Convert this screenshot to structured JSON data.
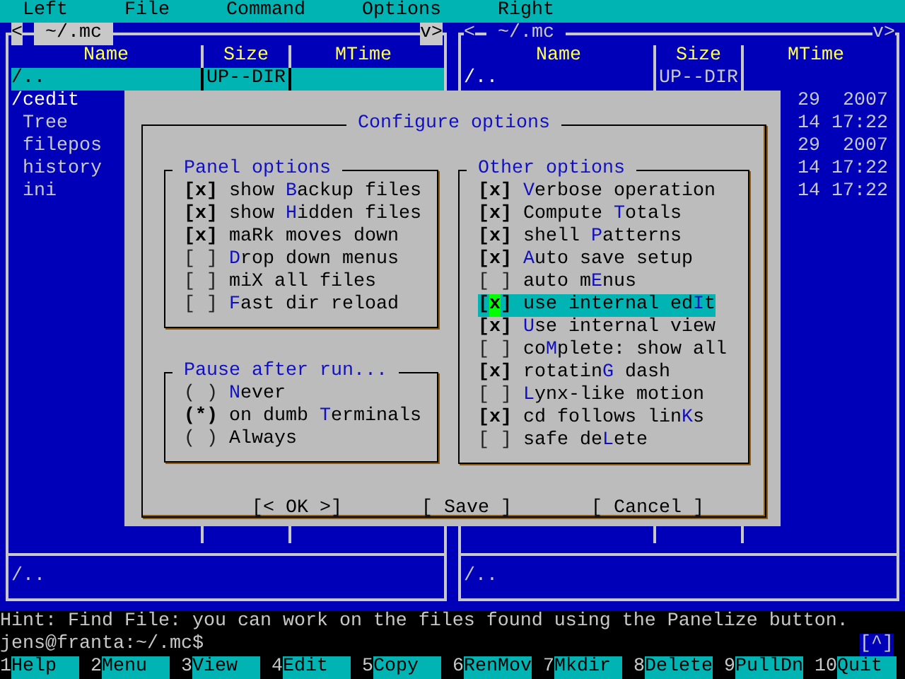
{
  "menu_bar": [
    "Left",
    "File",
    "Command",
    "Options",
    "Right"
  ],
  "panels": [
    {
      "active": true,
      "scroll_left": "<",
      "path": "~/.mc",
      "scroll_right": "v>",
      "columns": [
        "Name",
        "Size",
        "MTime"
      ],
      "cursor_row": {
        "name": "/..",
        "size": "UP--DIR",
        "kind": "dir"
      },
      "rows": [
        {
          "name": "/cedit",
          "kind": "dir"
        },
        {
          "name": "Tree",
          "kind": "file"
        },
        {
          "name": "filepos",
          "kind": "file"
        },
        {
          "name": "history",
          "kind": "file"
        },
        {
          "name": "ini",
          "kind": "file"
        }
      ],
      "status": "/.."
    },
    {
      "active": false,
      "scroll_left": "<",
      "path": "~/.mc",
      "scroll_right": "v>",
      "columns": [
        "Name",
        "Size",
        "MTime"
      ],
      "cursor_row": {
        "name": "/..",
        "size": "UP--DIR",
        "kind": "dir"
      },
      "rows": [
        {
          "mtime": "29  2007"
        },
        {
          "mtime": "14 17:22"
        },
        {
          "mtime": "29  2007"
        },
        {
          "mtime": "14 17:22"
        },
        {
          "mtime": "14 17:22"
        }
      ],
      "status": "/.."
    }
  ],
  "dialog": {
    "title": "Configure options",
    "columns": [
      {
        "groups": [
          {
            "title": "Panel options",
            "kind": "checkbox",
            "items": [
              {
                "box": "[x]",
                "checked": true,
                "focused": false,
                "pre": "show ",
                "key": "B",
                "post": "ackup files"
              },
              {
                "box": "[x]",
                "checked": true,
                "focused": false,
                "pre": "show ",
                "key": "H",
                "post": "idden files"
              },
              {
                "box": "[x]",
                "checked": true,
                "focused": false,
                "pre": "maRk moves down"
              },
              {
                "box": "[ ]",
                "checked": false,
                "focused": false,
                "key": "D",
                "post": "rop down menus"
              },
              {
                "box": "[ ]",
                "checked": false,
                "focused": false,
                "pre": "miX all files"
              },
              {
                "box": "[ ]",
                "checked": false,
                "focused": false,
                "key": "F",
                "post": "ast dir reload"
              }
            ]
          },
          {
            "title": "Pause after run...",
            "kind": "radio",
            "items": [
              {
                "box": "( )",
                "selected": false,
                "focused": false,
                "key": "N",
                "post": "ever"
              },
              {
                "box": "(*)",
                "selected": true,
                "focused": false,
                "pre": "on dumb ",
                "key": "T",
                "post": "erminals"
              },
              {
                "box": "( )",
                "selected": false,
                "focused": false,
                "pre": "Always"
              }
            ]
          }
        ]
      },
      {
        "groups": [
          {
            "title": "Other options",
            "kind": "checkbox",
            "items": [
              {
                "box": "[x]",
                "checked": true,
                "focused": false,
                "key": "V",
                "post": "erbose operation"
              },
              {
                "box": "[x]",
                "checked": true,
                "focused": false,
                "pre": "Compute ",
                "key": "T",
                "post": "otals"
              },
              {
                "box": "[x]",
                "checked": true,
                "focused": false,
                "pre": "shell ",
                "key": "P",
                "post": "atterns"
              },
              {
                "box": "[x]",
                "checked": true,
                "focused": false,
                "key": "A",
                "post": "uto save setup"
              },
              {
                "box": "[ ]",
                "checked": false,
                "focused": false,
                "pre": "auto m",
                "key": "E",
                "post": "nus"
              },
              {
                "box": "[x]",
                "checked": true,
                "focused": true,
                "pre": "use internal ed",
                "key": "I",
                "post": "t"
              },
              {
                "box": "[x]",
                "checked": true,
                "focused": false,
                "key": "U",
                "post": "se internal view"
              },
              {
                "box": "[ ]",
                "checked": false,
                "focused": false,
                "pre": "co",
                "key": "M",
                "post": "plete: show all"
              },
              {
                "box": "[x]",
                "checked": true,
                "focused": false,
                "pre": "rotatin",
                "key": "G",
                "post": " dash"
              },
              {
                "box": "[ ]",
                "checked": false,
                "focused": false,
                "key": "L",
                "post": "ynx-like motion"
              },
              {
                "box": "[x]",
                "checked": true,
                "focused": false,
                "pre": "cd follows lin",
                "key": "K",
                "post": "s"
              },
              {
                "box": "[ ]",
                "checked": false,
                "focused": false,
                "pre": "safe de",
                "key": "L",
                "post": "ete"
              }
            ]
          }
        ]
      }
    ],
    "buttons": [
      "[< OK >]",
      "[ Save ]",
      "[ Cancel ]"
    ]
  },
  "hint": "Hint: Find File: you can work on the files found using the Panelize button.",
  "prompt": "jens@franta:~/.mc$",
  "subshell_indicator": "[^]",
  "function_keys": [
    {
      "key": "1",
      "label": "Help"
    },
    {
      "key": "2",
      "label": "Menu"
    },
    {
      "key": "3",
      "label": "View"
    },
    {
      "key": "4",
      "label": "Edit"
    },
    {
      "key": "5",
      "label": "Copy"
    },
    {
      "key": "6",
      "label": "RenMov"
    },
    {
      "key": "7",
      "label": "Mkdir"
    },
    {
      "key": "8",
      "label": "Delete"
    },
    {
      "key": "9",
      "label": "PullDn"
    },
    {
      "key": "10",
      "label": "Quit"
    }
  ]
}
